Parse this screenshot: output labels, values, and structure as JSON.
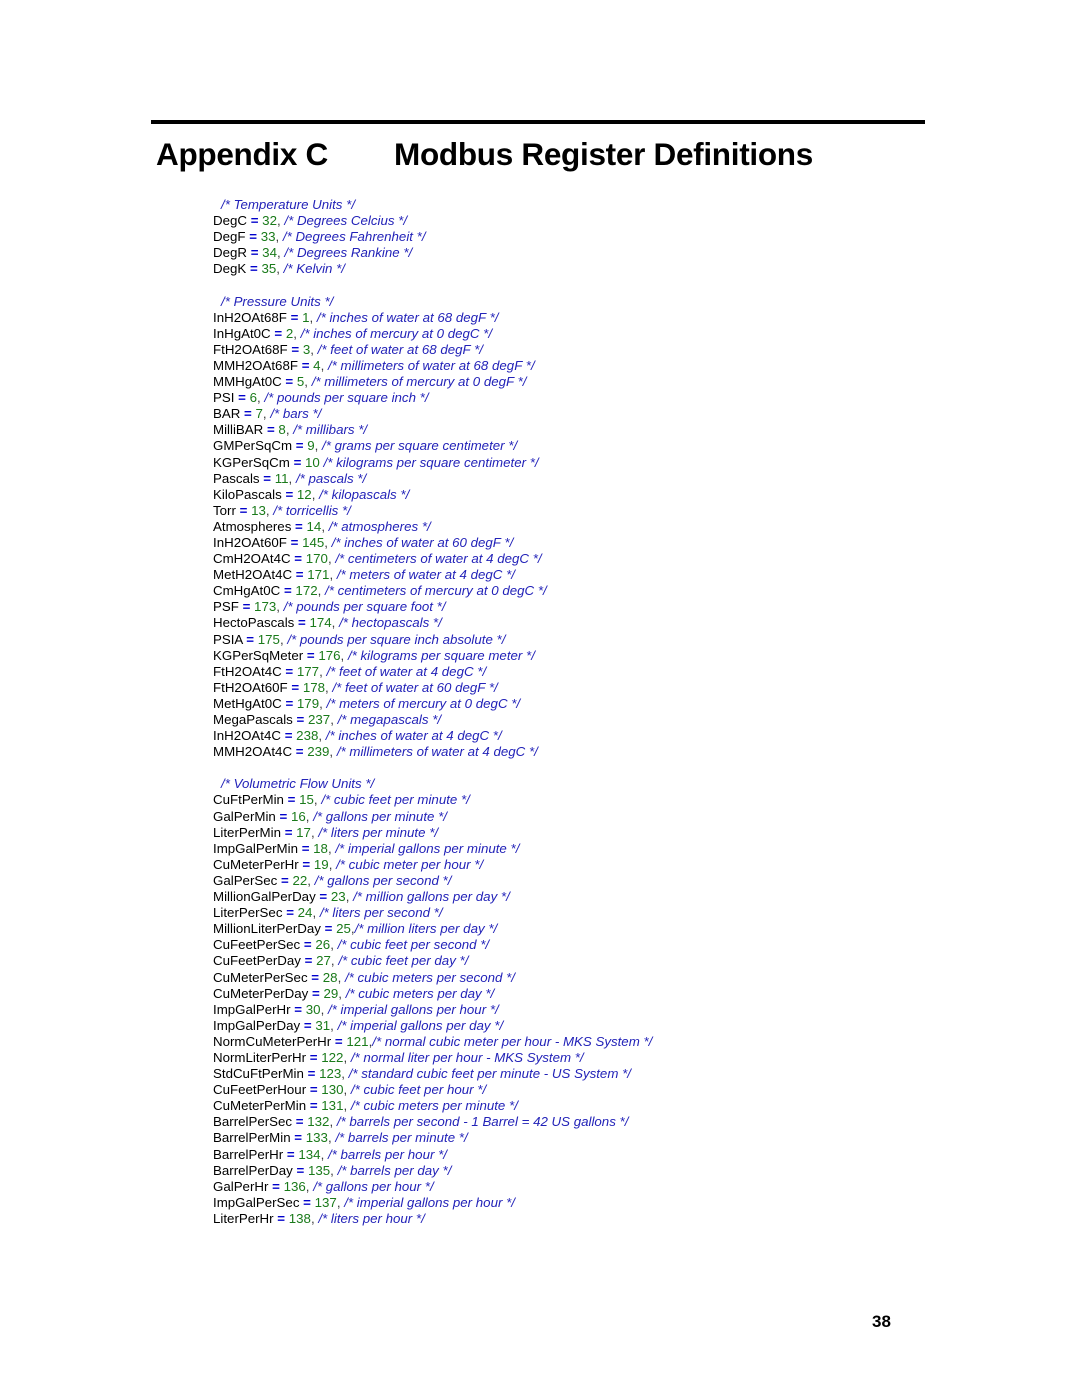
{
  "header": {
    "appendix_label": "Appendix C",
    "title": "Modbus Register Definitions"
  },
  "footer": {
    "page_number": "38"
  },
  "sections": [
    {
      "heading": "/* Temperature Units */",
      "entries": [
        {
          "name": "DegC",
          "eq": "=",
          "value": "32",
          "sep": ",",
          "comment": "/* Degrees Celcius */"
        },
        {
          "name": "DegF",
          "eq": "=",
          "value": "33",
          "sep": ",",
          "comment": "/* Degrees Fahrenheit */"
        },
        {
          "name": "DegR",
          "eq": "=",
          "value": "34",
          "sep": ",",
          "comment": "/* Degrees Rankine */"
        },
        {
          "name": "DegK",
          "eq": "=",
          "value": "35",
          "sep": ",",
          "comment": "/* Kelvin */"
        }
      ]
    },
    {
      "heading": "/* Pressure Units */",
      "entries": [
        {
          "name": "InH2OAt68F",
          "eq": "=",
          "value": "1",
          "sep": ",",
          "comment": "/* inches of water at 68 degF */"
        },
        {
          "name": "InHgAt0C",
          "eq": "=",
          "value": "2",
          "sep": ",",
          "comment": "/* inches of mercury at 0 degC */"
        },
        {
          "name": "FtH2OAt68F",
          "eq": "=",
          "value": "3",
          "sep": ",",
          "comment": "/* feet of water at 68 degF */"
        },
        {
          "name": "MMH2OAt68F",
          "eq": "=",
          "value": "4",
          "sep": ",",
          "comment": "/* millimeters of water at 68 degF */"
        },
        {
          "name": "MMHgAt0C",
          "eq": "=",
          "value": "5",
          "sep": ",",
          "comment": "/* millimeters of mercury at 0 degF */"
        },
        {
          "name": "PSI",
          "eq": "=",
          "value": "6",
          "sep": ",",
          "comment": "/* pounds per square inch */"
        },
        {
          "name": "BAR",
          "eq": "=",
          "value": "7",
          "sep": ",",
          "comment": "/* bars */"
        },
        {
          "name": "MilliBAR",
          "eq": "=",
          "value": "8",
          "sep": ",",
          "comment": "/* millibars */"
        },
        {
          "name": "GMPerSqCm",
          "eq": "=",
          "value": "9",
          "sep": ",",
          "comment": "/* grams per square centimeter */"
        },
        {
          "name": "KGPerSqCm",
          "eq": "=",
          "value": "10",
          "sep": "",
          "comment": "/* kilograms per square centimeter */"
        },
        {
          "name": "Pascals",
          "eq": "=",
          "value": "11",
          "sep": ",",
          "comment": "/* pascals */"
        },
        {
          "name": "KiloPascals",
          "eq": "=",
          "value": "12",
          "sep": ",",
          "comment": "/* kilopascals */"
        },
        {
          "name": "Torr",
          "eq": "=",
          "value": "13",
          "sep": ",",
          "comment": "/* torricellis */"
        },
        {
          "name": "Atmospheres",
          "eq": "=",
          "value": "14",
          "sep": ",",
          "comment": "/* atmospheres */"
        },
        {
          "name": "InH2OAt60F",
          "eq": "=",
          "value": "145",
          "sep": ",",
          "comment": "/* inches of water at 60 degF */"
        },
        {
          "name": "CmH2OAt4C",
          "eq": "=",
          "value": "170",
          "sep": ",",
          "comment": "/* centimeters of water at 4 degC */"
        },
        {
          "name": "MetH2OAt4C",
          "eq": "=",
          "value": "171",
          "sep": ",",
          "comment": "/* meters of water at 4 degC */"
        },
        {
          "name": "CmHgAt0C",
          "eq": "=",
          "value": "172",
          "sep": ",",
          "comment": "/* centimeters of mercury at 0 degC */"
        },
        {
          "name": "PSF",
          "eq": "=",
          "value": "173",
          "sep": ",",
          "comment": "/* pounds per square foot */"
        },
        {
          "name": "HectoPascals",
          "eq": "=",
          "value": "174",
          "sep": ",",
          "comment": "/* hectopascals */"
        },
        {
          "name": "PSIA",
          "eq": "=",
          "value": "175",
          "sep": ",",
          "comment": "/* pounds per square inch absolute */"
        },
        {
          "name": "KGPerSqMeter",
          "eq": "=",
          "value": "176",
          "sep": ",",
          "comment": "/* kilograms per square meter */"
        },
        {
          "name": "FtH2OAt4C",
          "eq": "=",
          "value": "177",
          "sep": ",",
          "comment": "/* feet of water at 4 degC */"
        },
        {
          "name": "FtH2OAt60F",
          "eq": "=",
          "value": "178",
          "sep": ",",
          "comment": "/* feet of water at 60 degF */"
        },
        {
          "name": "MetHgAt0C",
          "eq": "=",
          "value": "179",
          "sep": ",",
          "comment": "/* meters of mercury at 0 degC */"
        },
        {
          "name": "MegaPascals",
          "eq": "=",
          "value": "237",
          "sep": ",",
          "comment": "/* megapascals */"
        },
        {
          "name": "InH2OAt4C",
          "eq": "=",
          "value": "238",
          "sep": ",",
          "comment": "/* inches of water at 4 degC */"
        },
        {
          "name": "MMH2OAt4C",
          "eq": "=",
          "value": "239",
          "sep": ",",
          "comment": "/* millimeters of water at 4 degC */"
        }
      ]
    },
    {
      "heading": "/* Volumetric Flow Units */",
      "entries": [
        {
          "name": "CuFtPerMin",
          "eq": "=",
          "value": "15",
          "sep": ",",
          "comment": "/* cubic feet per minute */"
        },
        {
          "name": "GalPerMin",
          "eq": "=",
          "value": "16",
          "sep": ",",
          "comment": "/* gallons per minute */"
        },
        {
          "name": "LiterPerMin",
          "eq": "=",
          "value": "17",
          "sep": ",",
          "comment": "/* liters per minute */"
        },
        {
          "name": "ImpGalPerMin",
          "eq": "=",
          "value": "18",
          "sep": ",",
          "comment": "/* imperial gallons per minute */"
        },
        {
          "name": "CuMeterPerHr",
          "eq": "=",
          "value": "19",
          "sep": ",",
          "comment": "/* cubic meter per hour */"
        },
        {
          "name": "GalPerSec",
          "eq": "=",
          "value": "22",
          "sep": ",",
          "comment": "/* gallons per second */"
        },
        {
          "name": "MillionGalPerDay",
          "eq": "=",
          "value": "23",
          "sep": ",",
          "comment": "/* million gallons per day */"
        },
        {
          "name": "LiterPerSec",
          "eq": "=",
          "value": "24",
          "sep": ",",
          "comment": "/* liters per second */"
        },
        {
          "name": "MillionLiterPerDay",
          "eq": "=",
          "value": "25",
          "sep": ",",
          "comment": "/* million liters per day */",
          "tight": true
        },
        {
          "name": "CuFeetPerSec",
          "eq": "=",
          "value": "26",
          "sep": ",",
          "comment": "/* cubic feet per second */"
        },
        {
          "name": "CuFeetPerDay",
          "eq": "=",
          "value": "27",
          "sep": ",",
          "comment": "/* cubic feet per day */"
        },
        {
          "name": "CuMeterPerSec",
          "eq": "=",
          "value": "28",
          "sep": ",",
          "comment": "/* cubic meters per second */"
        },
        {
          "name": "CuMeterPerDay",
          "eq": "=",
          "value": "29",
          "sep": ",",
          "comment": "/* cubic meters per day */"
        },
        {
          "name": "ImpGalPerHr",
          "eq": "=",
          "value": "30",
          "sep": ",",
          "comment": "/* imperial gallons per hour */"
        },
        {
          "name": "ImpGalPerDay",
          "eq": "=",
          "value": "31",
          "sep": ",",
          "comment": "/* imperial gallons per day */"
        },
        {
          "name": "NormCuMeterPerHr",
          "eq": "=",
          "value": "121",
          "sep": ",",
          "comment": "/* normal cubic meter per hour - MKS System */",
          "tight": true
        },
        {
          "name": "NormLiterPerHr",
          "eq": "=",
          "value": "122",
          "sep": ",",
          "comment": "/* normal liter per hour - MKS System */"
        },
        {
          "name": "StdCuFtPerMin",
          "eq": "=",
          "value": "123",
          "sep": ",",
          "comment": "/* standard cubic feet per minute - US System */"
        },
        {
          "name": "CuFeetPerHour",
          "eq": "=",
          "value": "130",
          "sep": ",",
          "comment": "/* cubic feet per hour */"
        },
        {
          "name": "CuMeterPerMin",
          "eq": "=",
          "value": "131",
          "sep": ",",
          "comment": "/* cubic meters per minute */"
        },
        {
          "name": "BarrelPerSec",
          "eq": "=",
          "value": "132",
          "sep": ",",
          "comment": "/* barrels per second - 1 Barrel = 42 US gallons */"
        },
        {
          "name": "BarrelPerMin",
          "eq": "=",
          "value": "133",
          "sep": ",",
          "comment": "/* barrels per minute */"
        },
        {
          "name": "BarrelPerHr",
          "eq": "=",
          "value": "134",
          "sep": ",",
          "comment": "/* barrels per hour */"
        },
        {
          "name": "BarrelPerDay",
          "eq": "=",
          "value": "135",
          "sep": ",",
          "comment": "/* barrels per day */"
        },
        {
          "name": "GalPerHr",
          "eq": "=",
          "value": "136",
          "sep": ",",
          "comment": "/* gallons per hour */"
        },
        {
          "name": "ImpGalPerSec",
          "eq": "=",
          "value": "137",
          "sep": ",",
          "comment": "/* imperial gallons per hour */"
        },
        {
          "name": "LiterPerHr",
          "eq": "=",
          "value": "138",
          "sep": ",",
          "comment": "/* liters per hour */"
        }
      ]
    }
  ],
  "colors": {
    "identifier": "#000000",
    "equals": "#0000cc",
    "number": "#1a7a1a",
    "comment": "#2222b8",
    "rule": "#000000"
  }
}
